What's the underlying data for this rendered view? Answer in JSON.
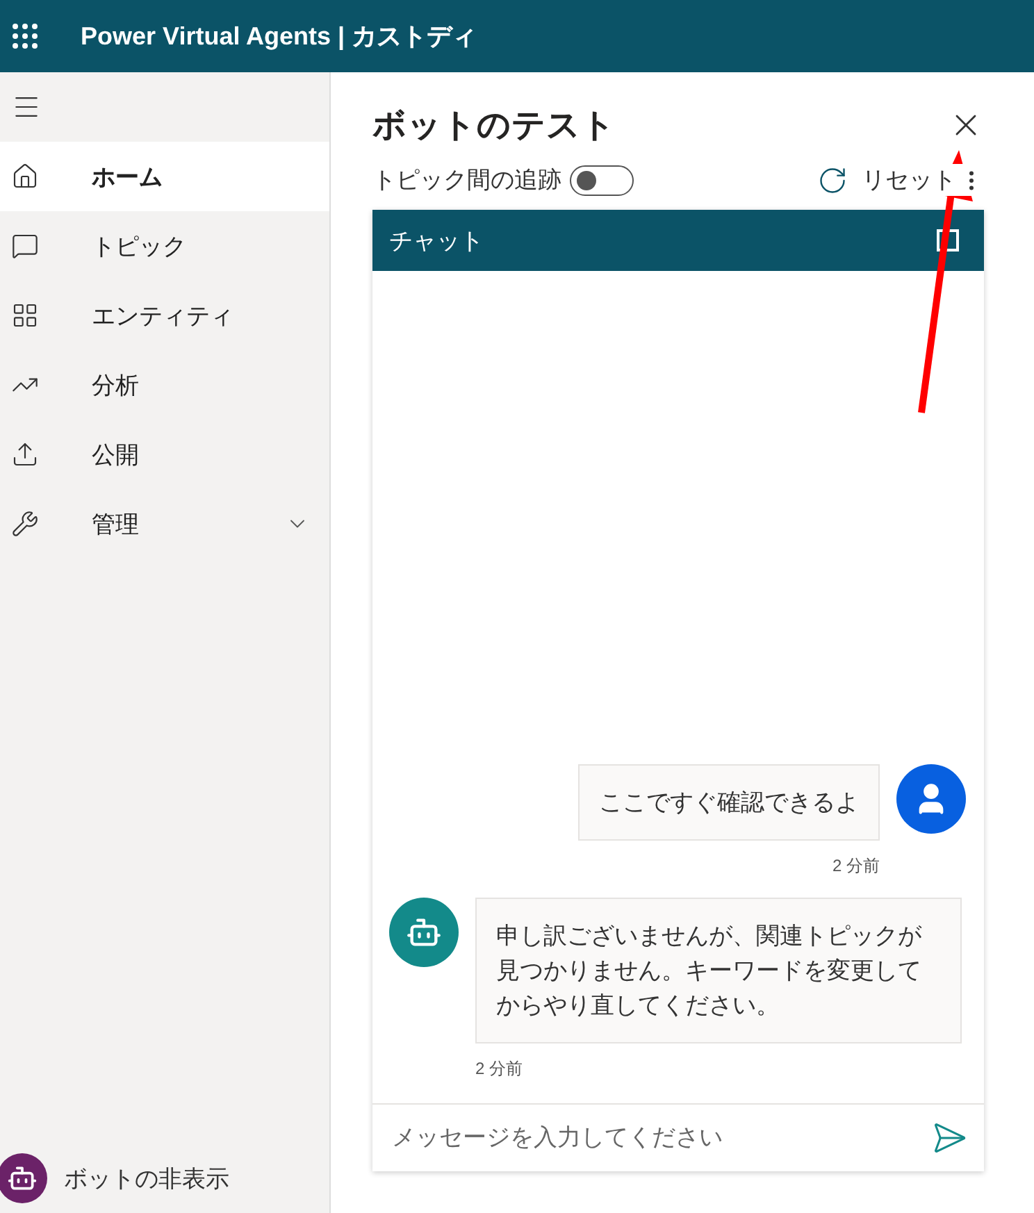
{
  "app": {
    "title": "Power Virtual Agents | カストディ"
  },
  "sidebar": {
    "items": [
      {
        "label": "ホーム",
        "kind": "page",
        "selected": true
      },
      {
        "label": "トピック",
        "kind": "page",
        "selected": false
      },
      {
        "label": "エンティティ",
        "kind": "page",
        "selected": false
      },
      {
        "label": "分析",
        "kind": "page",
        "selected": false
      },
      {
        "label": "公開",
        "kind": "page",
        "selected": false
      },
      {
        "label": "管理",
        "kind": "group",
        "selected": false
      }
    ],
    "footer": "ボットの非表示"
  },
  "panel": {
    "title": "ボットのテスト",
    "tracking": {
      "label": "トピック間の追跡",
      "on": false
    },
    "reset": "リセット",
    "chat": {
      "title": "チャット",
      "messages": [
        {
          "kind": "sent",
          "text": "ここですぐ確認できるよ",
          "time": "2 分前"
        },
        {
          "kind": "received",
          "text": "申し訳ございませんが、関連トピックが見つかりません。キーワードを変更してからやり直してください。",
          "time": "2 分前"
        }
      ],
      "input": {
        "placeholder": "メッセージを入力してください"
      }
    }
  }
}
